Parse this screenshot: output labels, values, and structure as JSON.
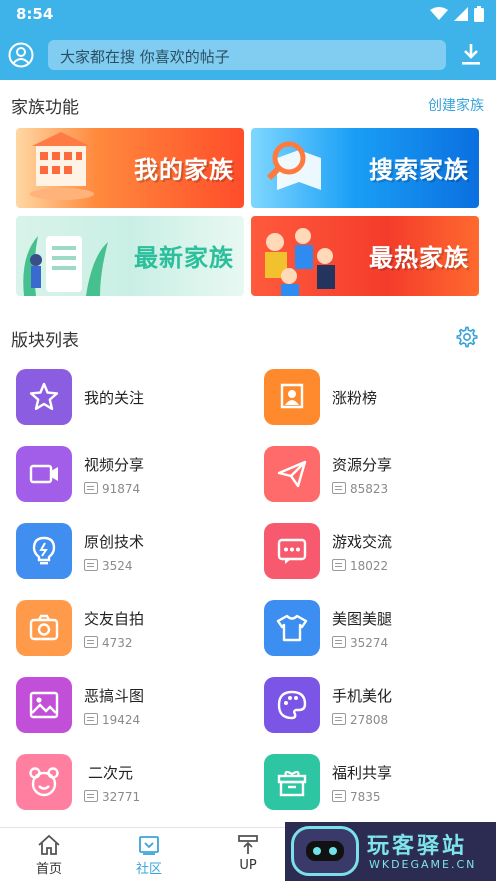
{
  "status_bar": {
    "time": "8:54"
  },
  "search": {
    "placeholder": "大家都在搜  你喜欢的帖子"
  },
  "family": {
    "title": "家族功能",
    "create_link": "创建家族",
    "banners": [
      "我的家族",
      "搜索家族",
      "最新家族",
      "最热家族"
    ]
  },
  "boards": {
    "title": "版块列表",
    "items": [
      {
        "name": "我的关注",
        "count": "",
        "color": "#8b5de0",
        "icon": "star-icon"
      },
      {
        "name": "涨粉榜",
        "count": "",
        "color": "#ff8a2d",
        "icon": "ranking-icon"
      },
      {
        "name": "视频分享",
        "count": "91874",
        "color": "#a25ee8",
        "icon": "video-icon"
      },
      {
        "name": "资源分享",
        "count": "85823",
        "color": "#ff6b6b",
        "icon": "paper-plane-icon"
      },
      {
        "name": "原创技术",
        "count": "3524",
        "color": "#3f8ef0",
        "icon": "lightbulb-icon"
      },
      {
        "name": "游戏交流",
        "count": "18022",
        "color": "#f75a6e",
        "icon": "chat-icon"
      },
      {
        "name": "交友自拍",
        "count": "4732",
        "color": "#ff9a4a",
        "icon": "camera-icon"
      },
      {
        "name": "美图美腿",
        "count": "35274",
        "color": "#3c8ef0",
        "icon": "shirt-icon"
      },
      {
        "name": "恶搞斗图",
        "count": "19424",
        "color": "#c24fd8",
        "icon": "image-icon"
      },
      {
        "name": "手机美化",
        "count": "27808",
        "color": "#7a55e6",
        "icon": "palette-icon"
      },
      {
        "name": "二次元",
        "count": "32771",
        "color": "#ff7fa1",
        "icon": "bear-icon"
      },
      {
        "name": "福利共享",
        "count": "7835",
        "color": "#2ec5a3",
        "icon": "gift-icon"
      }
    ]
  },
  "bottom_nav": [
    {
      "label": "首页",
      "active": false
    },
    {
      "label": "社区",
      "active": true
    },
    {
      "label": "UP",
      "active": false
    }
  ],
  "watermark": {
    "title": "玩客驿站",
    "subtitle": "WKDEGAME.CN"
  },
  "colors": {
    "accent": "#3db3ea",
    "link": "#3aa4da"
  }
}
